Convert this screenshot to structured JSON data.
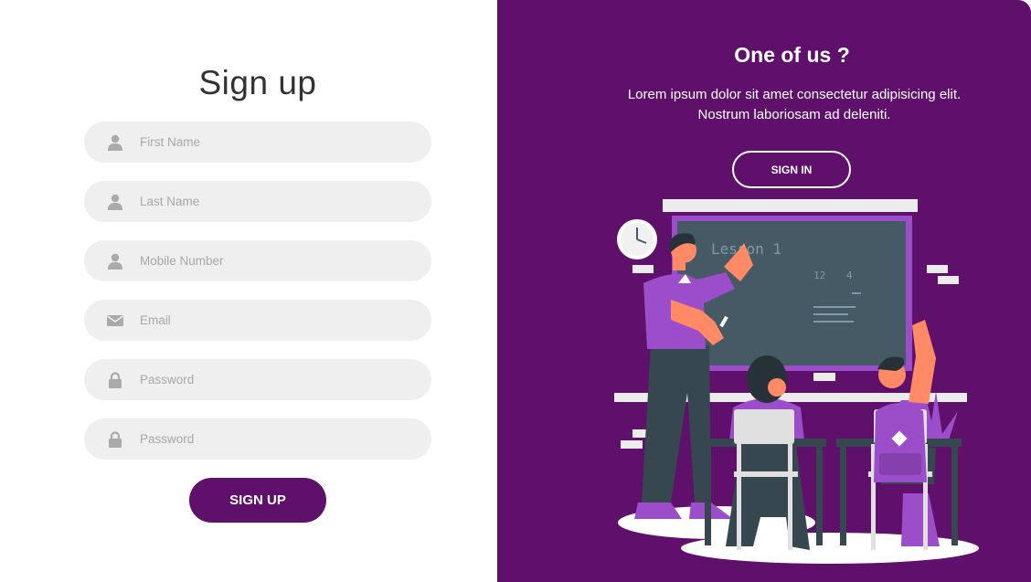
{
  "signup": {
    "title": "Sign up",
    "fields": [
      {
        "placeholder": "First Name",
        "icon": "user-icon"
      },
      {
        "placeholder": "Last Name",
        "icon": "user-icon"
      },
      {
        "placeholder": "Mobile Number",
        "icon": "user-icon"
      },
      {
        "placeholder": "Email",
        "icon": "envelope-icon"
      },
      {
        "placeholder": "Password",
        "icon": "lock-icon"
      },
      {
        "placeholder": "Password",
        "icon": "lock-icon"
      }
    ],
    "submit_label": "SIGN UP"
  },
  "panel": {
    "title": "One of us ?",
    "description": "Lorem ipsum dolor sit amet consectetur adipisicing elit. Nostrum laboriosam ad deleniti.",
    "signin_label": "SIGN IN",
    "illustration": {
      "board_text": "Lesson 1",
      "board_numbers": [
        "12",
        "4"
      ]
    }
  },
  "colors": {
    "accent": "#5f106a",
    "field_bg": "#efefef",
    "placeholder": "#a8a8a8",
    "illustration_purple": "#9b4dca",
    "board": "#455a64"
  }
}
